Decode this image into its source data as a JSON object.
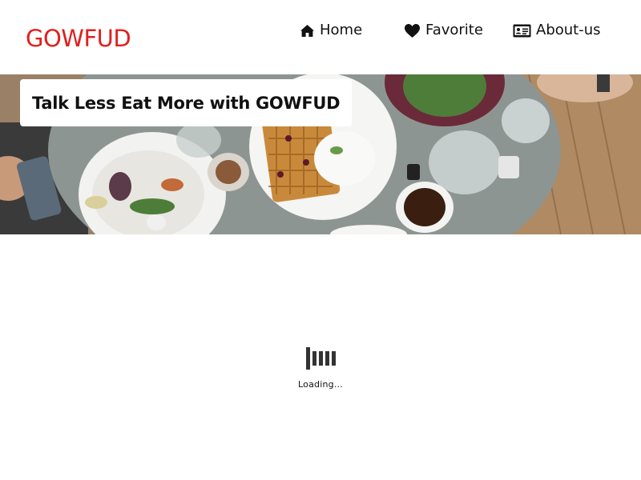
{
  "brand": {
    "name": "GOWFUD",
    "color": "#e0201f"
  },
  "nav": {
    "items": [
      {
        "label": "Home",
        "icon": "home-icon"
      },
      {
        "label": "Favorite",
        "icon": "heart-icon"
      },
      {
        "label": "About-us",
        "icon": "id-card-icon"
      }
    ]
  },
  "hero": {
    "title": "Talk Less Eat More with GOWFUD",
    "image": "food-table-photo"
  },
  "loader": {
    "text": "Loading..."
  }
}
